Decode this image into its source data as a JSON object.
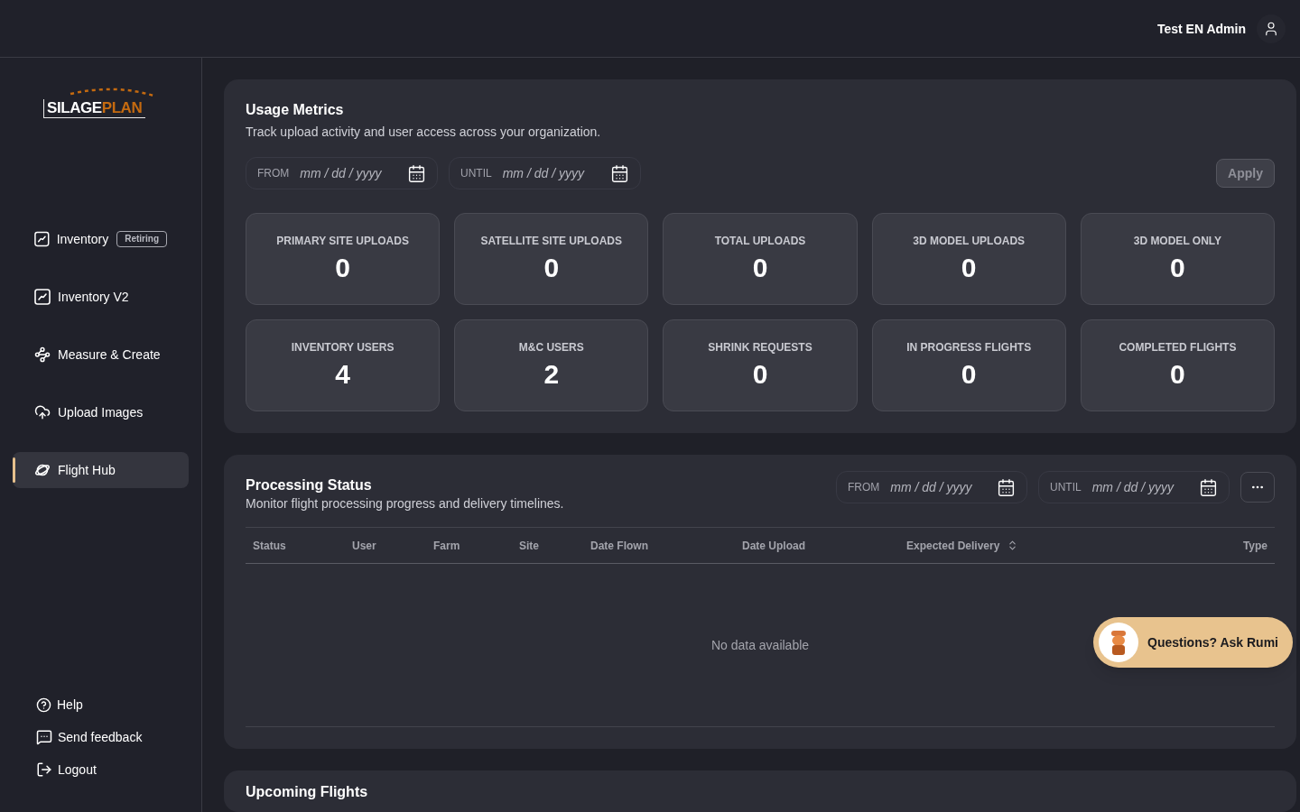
{
  "header": {
    "user_name": "Test EN Admin"
  },
  "logo": {
    "parts": [
      "SILAGE",
      "PLAN"
    ]
  },
  "sidebar": {
    "items": [
      {
        "label": "Inventory",
        "kind": "chart",
        "badge": "Retiring",
        "selected": false
      },
      {
        "label": "Inventory V2",
        "kind": "chart",
        "selected": false
      },
      {
        "label": "Measure & Create",
        "kind": "nodes",
        "selected": false
      },
      {
        "label": "Upload Images",
        "kind": "upload",
        "selected": false
      },
      {
        "label": "Flight Hub",
        "kind": "planet",
        "selected": true
      }
    ],
    "footer": [
      {
        "label": "Help",
        "kind": "help"
      },
      {
        "label": "Send feedback",
        "kind": "feedback"
      },
      {
        "label": "Logout",
        "kind": "logout"
      }
    ]
  },
  "usage_metrics": {
    "title": "Usage Metrics",
    "subtitle": "Track upload activity and user access across your organization.",
    "date_fields": [
      {
        "label": "FROM",
        "placeholder": "mm / dd / yyyy"
      },
      {
        "label": "UNTIL",
        "placeholder": "mm / dd / yyyy"
      }
    ],
    "apply_button": {
      "label": "Apply",
      "disabled": true
    },
    "stats": [
      {
        "label": "PRIMARY SITE UPLOADS",
        "value": "0"
      },
      {
        "label": "SATELLITE SITE UPLOADS",
        "value": "0"
      },
      {
        "label": "TOTAL UPLOADS",
        "value": "0"
      },
      {
        "label": "3D MODEL UPLOADS",
        "value": "0"
      },
      {
        "label": "3D MODEL ONLY",
        "value": "0"
      },
      {
        "label": "INVENTORY USERS",
        "value": "4"
      },
      {
        "label": "M&C USERS",
        "value": "2"
      },
      {
        "label": "SHRINK REQUESTS",
        "value": "0"
      },
      {
        "label": "IN PROGRESS FLIGHTS",
        "value": "0"
      },
      {
        "label": "COMPLETED FLIGHTS",
        "value": "0"
      }
    ]
  },
  "processing_status": {
    "title": "Processing Status",
    "subtitle": "Monitor flight processing progress and delivery timelines.",
    "date_fields": [
      {
        "label": "FROM",
        "placeholder": "mm / dd / yyyy"
      },
      {
        "label": "UNTIL",
        "placeholder": "mm / dd / yyyy"
      }
    ],
    "table": {
      "columns": [
        {
          "label": "Status",
          "sortable": false
        },
        {
          "label": "User",
          "sortable": false
        },
        {
          "label": "Farm",
          "sortable": false
        },
        {
          "label": "Site",
          "sortable": false
        },
        {
          "label": "Date Flown",
          "sortable": false
        },
        {
          "label": "Date Upload",
          "sortable": false
        },
        {
          "label": "Expected Delivery",
          "sortable": true
        },
        {
          "label": "Type",
          "sortable": false
        }
      ],
      "empty_message": "No data available"
    }
  },
  "upcoming_flights": {
    "title": "Upcoming Flights"
  },
  "chat_button": {
    "label": "Questions? Ask Rumi"
  }
}
